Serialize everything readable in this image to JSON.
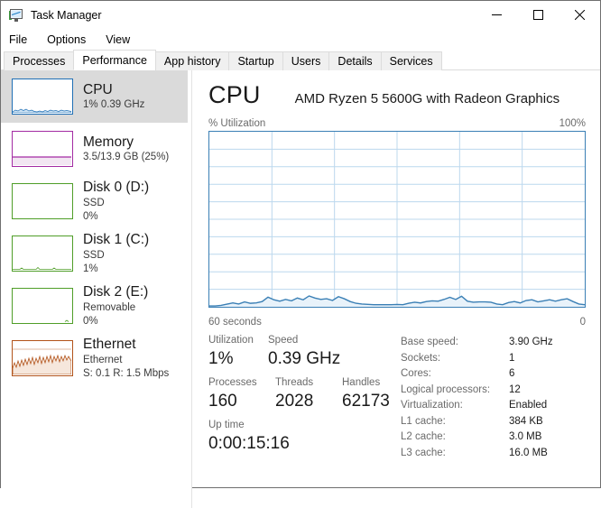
{
  "window": {
    "title": "Task Manager",
    "icon": "task-manager-icon",
    "minimize_label": "–",
    "maximize_label": "□",
    "close_label": "✕"
  },
  "menubar": {
    "items": [
      "File",
      "Options",
      "View"
    ]
  },
  "tabs": [
    {
      "label": "Processes",
      "active": false
    },
    {
      "label": "Performance",
      "active": true
    },
    {
      "label": "App history",
      "active": false
    },
    {
      "label": "Startup",
      "active": false
    },
    {
      "label": "Users",
      "active": false
    },
    {
      "label": "Details",
      "active": false
    },
    {
      "label": "Services",
      "active": false
    }
  ],
  "sidebar": {
    "items": [
      {
        "name": "CPU",
        "title": "CPU",
        "sub1": "1%  0.39 GHz",
        "sub2": "",
        "selected": true,
        "color": "#1f6fb5"
      },
      {
        "name": "Memory",
        "title": "Memory",
        "sub1": "3.5/13.9 GB (25%)",
        "sub2": "",
        "selected": false,
        "color": "#a32ba3"
      },
      {
        "name": "Disk 0",
        "title": "Disk 0 (D:)",
        "sub1": "SSD",
        "sub2": "0%",
        "selected": false,
        "color": "#4f9e28"
      },
      {
        "name": "Disk 1",
        "title": "Disk 1 (C:)",
        "sub1": "SSD",
        "sub2": "1%",
        "selected": false,
        "color": "#4f9e28"
      },
      {
        "name": "Disk 2",
        "title": "Disk 2 (E:)",
        "sub1": "Removable",
        "sub2": "0%",
        "selected": false,
        "color": "#4f9e28"
      },
      {
        "name": "Ethernet",
        "title": "Ethernet",
        "sub1": "Ethernet",
        "sub2": "S: 0.1 R: 1.5 Mbps",
        "selected": false,
        "color": "#b2531a"
      }
    ]
  },
  "main": {
    "title": "CPU",
    "subtitle": "AMD Ryzen 5 5600G with Radeon Graphics",
    "graph_label": "% Utilization",
    "graph_max": "100%",
    "time_left": "60 seconds",
    "time_right": "0",
    "stats": {
      "utilization_label": "Utilization",
      "utilization_value": "1%",
      "speed_label": "Speed",
      "speed_value": "0.39 GHz",
      "processes_label": "Processes",
      "processes_value": "160",
      "threads_label": "Threads",
      "threads_value": "2028",
      "handles_label": "Handles",
      "handles_value": "62173",
      "uptime_label": "Up time",
      "uptime_value": "0:00:15:16"
    },
    "specs": [
      {
        "key": "Base speed:",
        "value": "3.90 GHz"
      },
      {
        "key": "Sockets:",
        "value": "1"
      },
      {
        "key": "Cores:",
        "value": "6"
      },
      {
        "key": "Logical processors:",
        "value": "12"
      },
      {
        "key": "Virtualization:",
        "value": "Enabled"
      },
      {
        "key": "L1 cache:",
        "value": "384 KB"
      },
      {
        "key": "L2 cache:",
        "value": "3.0 MB"
      },
      {
        "key": "L3 cache:",
        "value": "16.0 MB"
      }
    ]
  },
  "chart_data": {
    "type": "area",
    "title": "CPU % Utilization",
    "xlabel": "60 seconds",
    "ylabel": "% Utilization",
    "ylim": [
      0,
      100
    ],
    "xlim": [
      60,
      0
    ],
    "grid": true,
    "accent_color": "#3a7fb5",
    "fill_color": "#e8f2fa",
    "x_tick_labels": [
      "60 seconds",
      "0"
    ],
    "y_tick_labels": [
      "100%"
    ],
    "v_gridlines": 6,
    "h_gridlines": 10,
    "values": [
      0.5,
      0.5,
      0.8,
      1.5,
      2.2,
      1.6,
      2.8,
      2.0,
      2.2,
      3.0,
      5.5,
      4.0,
      3.2,
      4.2,
      3.4,
      5.0,
      4.0,
      6.2,
      5.0,
      4.2,
      4.6,
      3.6,
      5.8,
      4.6,
      3.0,
      2.0,
      1.6,
      1.4,
      1.2,
      1.2,
      1.2,
      1.2,
      1.3,
      1.2,
      2.0,
      2.6,
      2.2,
      3.0,
      3.4,
      3.2,
      4.2,
      5.4,
      4.2,
      6.0,
      3.2,
      2.6,
      2.8,
      2.8,
      2.6,
      1.6,
      1.2,
      2.4,
      3.0,
      2.2,
      3.6,
      4.0,
      2.8,
      3.4,
      4.0,
      3.2,
      4.0,
      4.6,
      3.0,
      1.6,
      1.2
    ]
  }
}
